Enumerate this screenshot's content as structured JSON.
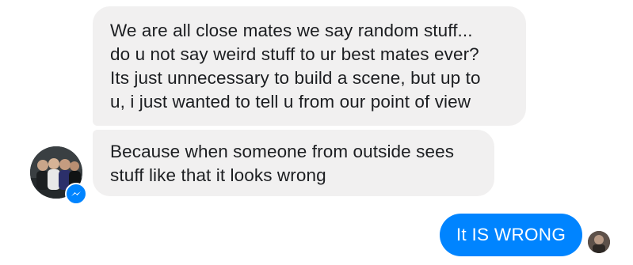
{
  "conversation": {
    "received_1": {
      "lines": [
        "We are all close mates we say random stuff...",
        "do u not say weird stuff to ur best mates ever?",
        "Its just unnecessary to build a scene, but up to",
        "u,  i just wanted to tell u from our point of view"
      ]
    },
    "received_2": {
      "lines": [
        "Because when someone from outside sees",
        "stuff like that it looks wrong"
      ]
    },
    "sent_1": {
      "text": "It IS WRONG"
    }
  },
  "icons": {
    "contact_avatar": "group-photo-avatar",
    "messenger_badge": "messenger-icon",
    "read_receipt": "read-receipt-avatar"
  },
  "colors": {
    "received_bubble": "#f1f0f0",
    "sent_bubble": "#0084ff",
    "messenger_blue": "#0084ff"
  }
}
